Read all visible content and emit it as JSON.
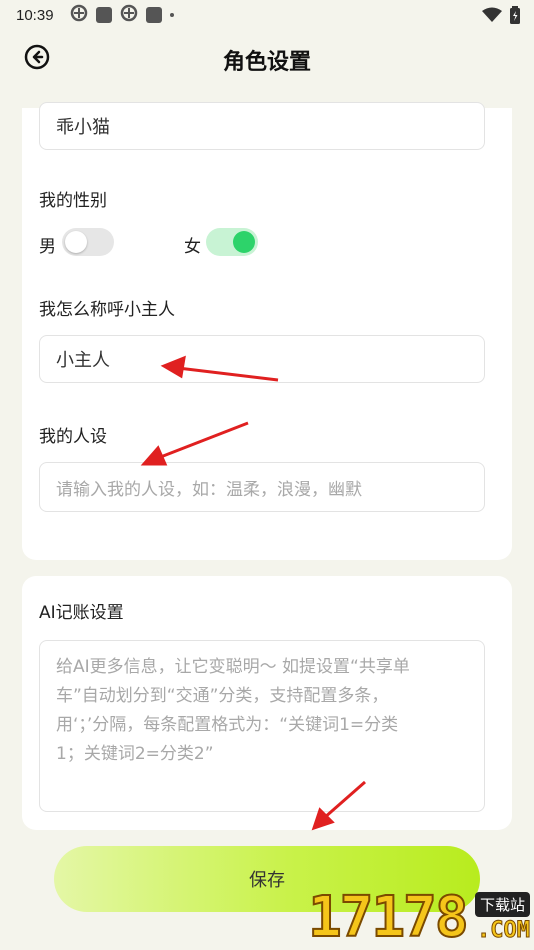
{
  "status_bar": {
    "time": "10:39",
    "icons": [
      "app-icon",
      "square-icon",
      "app-icon",
      "square-icon",
      "dot-icon"
    ],
    "right_icons": [
      "wifi-icon",
      "battery-icon"
    ]
  },
  "header": {
    "title": "角色设置",
    "back_icon": "back-arrow-circle-icon"
  },
  "role_card": {
    "name_value": "乖小猫",
    "gender_label": "我的性别",
    "gender_options": [
      {
        "label": "男",
        "selected": false
      },
      {
        "label": "女",
        "selected": true
      }
    ],
    "address_label": "我怎么称呼小主人",
    "address_value": "小主人",
    "persona_label": "我的人设",
    "persona_placeholder": "请输入我的人设，如：温柔，浪漫，幽默"
  },
  "ai_card": {
    "title": "AI记账设置",
    "placeholder_lines": [
      "给AI更多信息，让它变聪明～ 如提设置“共享单",
      "车”自动划分到“交通”分类，支持配置多条，",
      "用‘；’分隔，每条配置格式为：“关键词1=分类",
      "1；关键词2=分类2”"
    ]
  },
  "save_button": {
    "label": "保存"
  },
  "watermark": {
    "digits": "17178",
    "label": "下载站",
    "suffix": ".COM"
  },
  "colors": {
    "background": "#f4f4ec",
    "toggle_on_knob": "#2dd36a",
    "toggle_on_track": "#c8f3d4",
    "button_gradient_end": "#b8ec1e",
    "arrow": "#e02020"
  }
}
